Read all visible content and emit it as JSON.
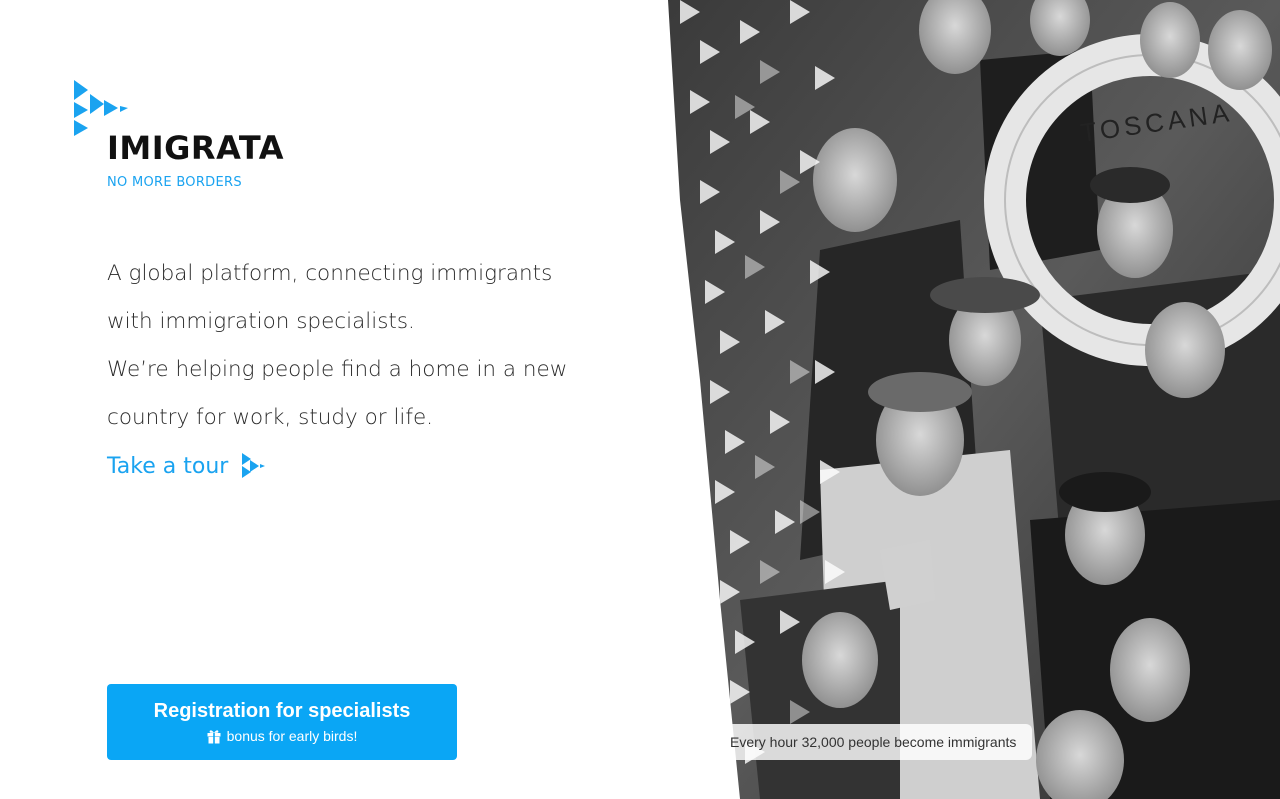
{
  "brand": {
    "name": "IMIGRATA",
    "tagline": "NO MORE BORDERS",
    "accent_color": "#1aa3f0"
  },
  "intro": {
    "line1": "A global platform, connecting immigrants with immigration specialists.",
    "line2": "We’re helping people find a home in a new country for work, study or life."
  },
  "tour_link": {
    "label": "Take a tour",
    "icon": "imigrata-arrow-icon"
  },
  "registration": {
    "title": "Registration for specialists",
    "subtitle": "bonus for early birds!",
    "icon": "gift-icon",
    "button_color": "#0aa6f5"
  },
  "hero": {
    "ship_ring_text": "TOSCANA",
    "stat": "Every hour 32,000 people become immigrants"
  }
}
